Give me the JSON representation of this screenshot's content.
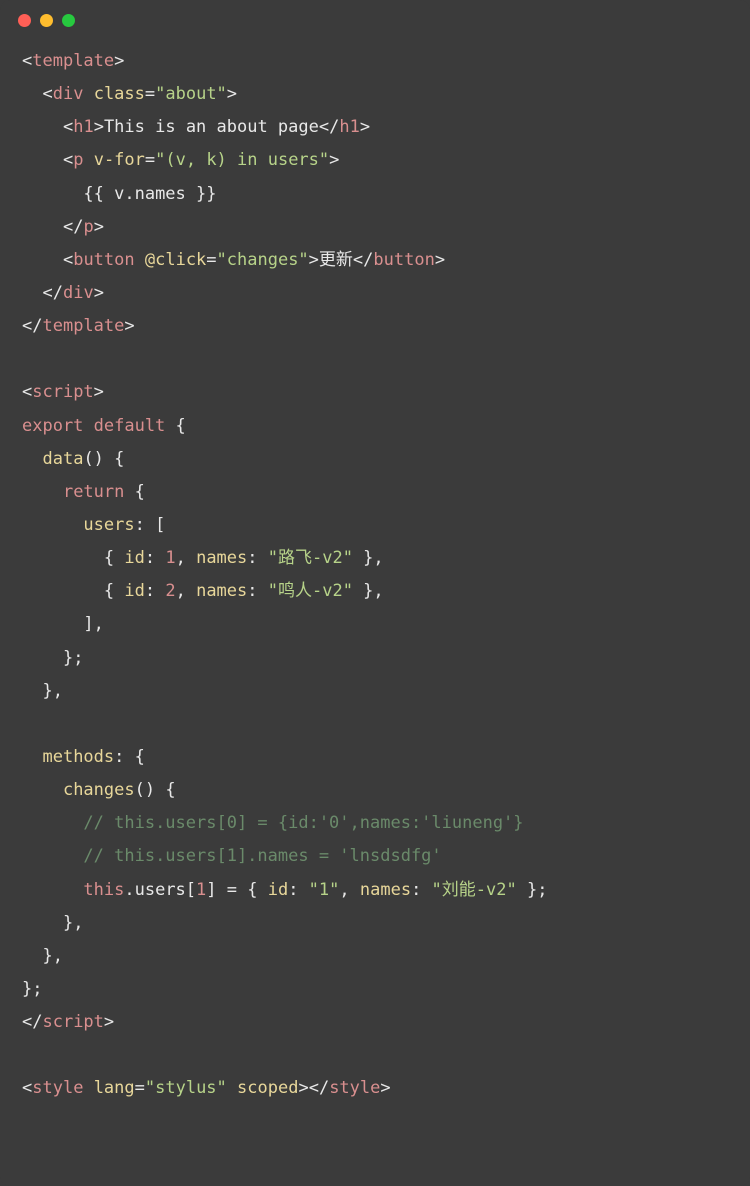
{
  "titlebar": {
    "dots": [
      "close",
      "minimize",
      "zoom"
    ]
  },
  "code": {
    "lines": [
      {
        "indent": 0,
        "tokens": [
          {
            "t": "<",
            "c": "plain"
          },
          {
            "t": "template",
            "c": "tag"
          },
          {
            "t": ">",
            "c": "plain"
          }
        ]
      },
      {
        "indent": 1,
        "tokens": [
          {
            "t": "<",
            "c": "plain"
          },
          {
            "t": "div",
            "c": "tag"
          },
          {
            "t": " ",
            "c": "plain"
          },
          {
            "t": "class",
            "c": "attr"
          },
          {
            "t": "=",
            "c": "plain"
          },
          {
            "t": "\"about\"",
            "c": "val"
          },
          {
            "t": ">",
            "c": "plain"
          }
        ]
      },
      {
        "indent": 2,
        "tokens": [
          {
            "t": "<",
            "c": "plain"
          },
          {
            "t": "h1",
            "c": "tag"
          },
          {
            "t": ">",
            "c": "plain"
          },
          {
            "t": "This is an about page",
            "c": "plain"
          },
          {
            "t": "</",
            "c": "plain"
          },
          {
            "t": "h1",
            "c": "tag"
          },
          {
            "t": ">",
            "c": "plain"
          }
        ]
      },
      {
        "indent": 2,
        "tokens": [
          {
            "t": "<",
            "c": "plain"
          },
          {
            "t": "p",
            "c": "tag"
          },
          {
            "t": " ",
            "c": "plain"
          },
          {
            "t": "v-for",
            "c": "attr"
          },
          {
            "t": "=",
            "c": "plain"
          },
          {
            "t": "\"(v, k) in users\"",
            "c": "val"
          },
          {
            "t": ">",
            "c": "plain"
          }
        ]
      },
      {
        "indent": 3,
        "tokens": [
          {
            "t": "{{ v.names }}",
            "c": "plain"
          }
        ]
      },
      {
        "indent": 2,
        "tokens": [
          {
            "t": "</",
            "c": "plain"
          },
          {
            "t": "p",
            "c": "tag"
          },
          {
            "t": ">",
            "c": "plain"
          }
        ]
      },
      {
        "indent": 2,
        "tokens": [
          {
            "t": "<",
            "c": "plain"
          },
          {
            "t": "button",
            "c": "tag"
          },
          {
            "t": " ",
            "c": "plain"
          },
          {
            "t": "@click",
            "c": "attr"
          },
          {
            "t": "=",
            "c": "plain"
          },
          {
            "t": "\"changes\"",
            "c": "val"
          },
          {
            "t": ">",
            "c": "plain"
          },
          {
            "t": "更新",
            "c": "plain"
          },
          {
            "t": "</",
            "c": "plain"
          },
          {
            "t": "button",
            "c": "tag"
          },
          {
            "t": ">",
            "c": "plain"
          }
        ]
      },
      {
        "indent": 1,
        "tokens": [
          {
            "t": "</",
            "c": "plain"
          },
          {
            "t": "div",
            "c": "tag"
          },
          {
            "t": ">",
            "c": "plain"
          }
        ]
      },
      {
        "indent": 0,
        "tokens": [
          {
            "t": "</",
            "c": "plain"
          },
          {
            "t": "template",
            "c": "tag"
          },
          {
            "t": ">",
            "c": "plain"
          }
        ]
      },
      {
        "indent": 0,
        "tokens": []
      },
      {
        "indent": 0,
        "tokens": [
          {
            "t": "<",
            "c": "plain"
          },
          {
            "t": "script",
            "c": "tag"
          },
          {
            "t": ">",
            "c": "plain"
          }
        ]
      },
      {
        "indent": 0,
        "tokens": [
          {
            "t": "export default",
            "c": "keyword"
          },
          {
            "t": " {",
            "c": "plain"
          }
        ]
      },
      {
        "indent": 1,
        "tokens": [
          {
            "t": "data",
            "c": "func"
          },
          {
            "t": "() {",
            "c": "plain"
          }
        ]
      },
      {
        "indent": 2,
        "tokens": [
          {
            "t": "return",
            "c": "keyword"
          },
          {
            "t": " {",
            "c": "plain"
          }
        ]
      },
      {
        "indent": 3,
        "tokens": [
          {
            "t": "users",
            "c": "prop"
          },
          {
            "t": ": [",
            "c": "plain"
          }
        ]
      },
      {
        "indent": 4,
        "tokens": [
          {
            "t": "{ ",
            "c": "plain"
          },
          {
            "t": "id",
            "c": "prop"
          },
          {
            "t": ": ",
            "c": "plain"
          },
          {
            "t": "1",
            "c": "num"
          },
          {
            "t": ", ",
            "c": "plain"
          },
          {
            "t": "names",
            "c": "prop"
          },
          {
            "t": ": ",
            "c": "plain"
          },
          {
            "t": "\"路飞-v2\"",
            "c": "str"
          },
          {
            "t": " },",
            "c": "plain"
          }
        ]
      },
      {
        "indent": 4,
        "tokens": [
          {
            "t": "{ ",
            "c": "plain"
          },
          {
            "t": "id",
            "c": "prop"
          },
          {
            "t": ": ",
            "c": "plain"
          },
          {
            "t": "2",
            "c": "num"
          },
          {
            "t": ", ",
            "c": "plain"
          },
          {
            "t": "names",
            "c": "prop"
          },
          {
            "t": ": ",
            "c": "plain"
          },
          {
            "t": "\"鸣人-v2\"",
            "c": "str"
          },
          {
            "t": " },",
            "c": "plain"
          }
        ]
      },
      {
        "indent": 3,
        "tokens": [
          {
            "t": "],",
            "c": "plain"
          }
        ]
      },
      {
        "indent": 2,
        "tokens": [
          {
            "t": "};",
            "c": "plain"
          }
        ]
      },
      {
        "indent": 1,
        "tokens": [
          {
            "t": "},",
            "c": "plain"
          }
        ]
      },
      {
        "indent": 0,
        "tokens": []
      },
      {
        "indent": 1,
        "tokens": [
          {
            "t": "methods",
            "c": "prop"
          },
          {
            "t": ": {",
            "c": "plain"
          }
        ]
      },
      {
        "indent": 2,
        "tokens": [
          {
            "t": "changes",
            "c": "func"
          },
          {
            "t": "() {",
            "c": "plain"
          }
        ]
      },
      {
        "indent": 3,
        "tokens": [
          {
            "t": "// this.users[0] = {id:'0',names:'liuneng'}",
            "c": "comment"
          }
        ]
      },
      {
        "indent": 3,
        "tokens": [
          {
            "t": "// this.users[1].names = 'lnsdsdfg'",
            "c": "comment"
          }
        ]
      },
      {
        "indent": 3,
        "tokens": [
          {
            "t": "this",
            "c": "keyword"
          },
          {
            "t": ".users[",
            "c": "plain"
          },
          {
            "t": "1",
            "c": "num"
          },
          {
            "t": "] = { ",
            "c": "plain"
          },
          {
            "t": "id",
            "c": "prop"
          },
          {
            "t": ": ",
            "c": "plain"
          },
          {
            "t": "\"1\"",
            "c": "str"
          },
          {
            "t": ", ",
            "c": "plain"
          },
          {
            "t": "names",
            "c": "prop"
          },
          {
            "t": ": ",
            "c": "plain"
          },
          {
            "t": "\"刘能-v2\"",
            "c": "str"
          },
          {
            "t": " };",
            "c": "plain"
          }
        ]
      },
      {
        "indent": 2,
        "tokens": [
          {
            "t": "},",
            "c": "plain"
          }
        ]
      },
      {
        "indent": 1,
        "tokens": [
          {
            "t": "},",
            "c": "plain"
          }
        ]
      },
      {
        "indent": 0,
        "tokens": [
          {
            "t": "};",
            "c": "plain"
          }
        ]
      },
      {
        "indent": 0,
        "tokens": [
          {
            "t": "</",
            "c": "plain"
          },
          {
            "t": "script",
            "c": "tag"
          },
          {
            "t": ">",
            "c": "plain"
          }
        ]
      },
      {
        "indent": 0,
        "tokens": []
      },
      {
        "indent": 0,
        "tokens": [
          {
            "t": "<",
            "c": "plain"
          },
          {
            "t": "style",
            "c": "tag"
          },
          {
            "t": " ",
            "c": "plain"
          },
          {
            "t": "lang",
            "c": "attr"
          },
          {
            "t": "=",
            "c": "plain"
          },
          {
            "t": "\"stylus\"",
            "c": "val"
          },
          {
            "t": " ",
            "c": "plain"
          },
          {
            "t": "scoped",
            "c": "attr"
          },
          {
            "t": ">",
            "c": "plain"
          },
          {
            "t": "</",
            "c": "plain"
          },
          {
            "t": "style",
            "c": "tag"
          },
          {
            "t": ">",
            "c": "plain"
          }
        ]
      }
    ]
  }
}
